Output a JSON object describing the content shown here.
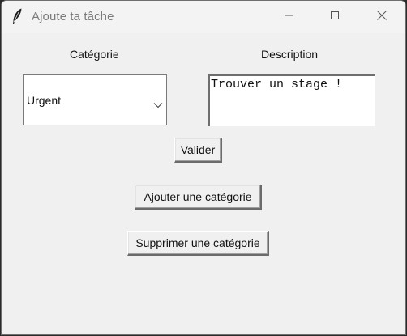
{
  "window": {
    "title": "Ajoute ta tâche"
  },
  "titlebar_buttons": {
    "minimize_icon": "minimize-icon",
    "maximize_icon": "maximize-icon",
    "close_icon": "close-icon"
  },
  "form": {
    "category_label": "Catégorie",
    "description_label": "Description",
    "category_value": "Urgent",
    "description_value": "Trouver un stage !"
  },
  "buttons": {
    "validate": "Valider",
    "add_category": "Ajouter une catégorie",
    "delete_category": "Supprimer une catégorie"
  },
  "colors": {
    "window_bg": "#f0f0f0",
    "input_bg": "#ffffff",
    "text": "#111111",
    "title_text": "#7b7b7b"
  }
}
